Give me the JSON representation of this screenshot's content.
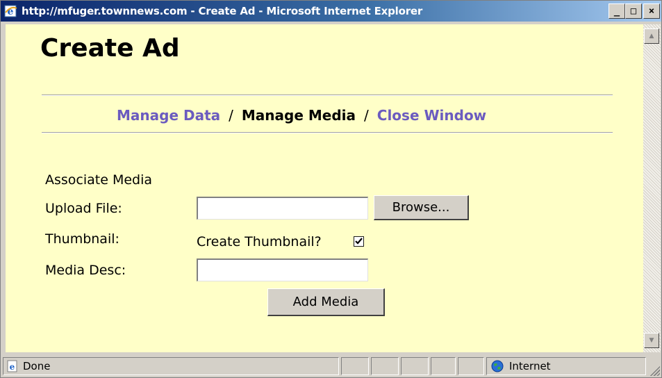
{
  "window": {
    "title": "http://mfuger.townnews.com - Create Ad - Microsoft Internet Explorer",
    "minimize_glyph": "_",
    "maximize_glyph": "□",
    "close_glyph": "×"
  },
  "page": {
    "title": "Create Ad",
    "nav": {
      "manage_data": "Manage Data",
      "manage_media": "Manage Media",
      "close_window": "Close Window",
      "separator": "/"
    },
    "form": {
      "section_label": "Associate Media",
      "upload_file_label": "Upload File:",
      "upload_file_value": "",
      "browse_button": "Browse...",
      "thumbnail_label": "Thumbnail:",
      "create_thumbnail_label": "Create Thumbnail?",
      "create_thumbnail_checked": true,
      "media_desc_label": "Media Desc:",
      "media_desc_value": "",
      "add_media_button": "Add Media"
    }
  },
  "statusbar": {
    "status_text": "Done",
    "zone_text": "Internet"
  },
  "colors": {
    "page_background": "#ffffc8",
    "link_color": "#6b5bbf",
    "titlebar_start": "#0a246a",
    "titlebar_end": "#a6caf0"
  },
  "icons": {
    "titlebar": "ie-logo-icon",
    "status": "ie-page-icon",
    "zone": "globe-icon"
  }
}
